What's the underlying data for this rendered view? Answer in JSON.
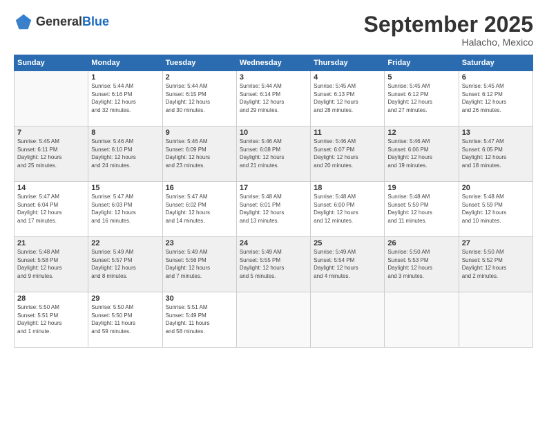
{
  "header": {
    "logo_general": "General",
    "logo_blue": "Blue",
    "month": "September 2025",
    "location": "Halacho, Mexico"
  },
  "days_of_week": [
    "Sunday",
    "Monday",
    "Tuesday",
    "Wednesday",
    "Thursday",
    "Friday",
    "Saturday"
  ],
  "weeks": [
    [
      {
        "day": "",
        "info": ""
      },
      {
        "day": "1",
        "info": "Sunrise: 5:44 AM\nSunset: 6:16 PM\nDaylight: 12 hours\nand 32 minutes."
      },
      {
        "day": "2",
        "info": "Sunrise: 5:44 AM\nSunset: 6:15 PM\nDaylight: 12 hours\nand 30 minutes."
      },
      {
        "day": "3",
        "info": "Sunrise: 5:44 AM\nSunset: 6:14 PM\nDaylight: 12 hours\nand 29 minutes."
      },
      {
        "day": "4",
        "info": "Sunrise: 5:45 AM\nSunset: 6:13 PM\nDaylight: 12 hours\nand 28 minutes."
      },
      {
        "day": "5",
        "info": "Sunrise: 5:45 AM\nSunset: 6:12 PM\nDaylight: 12 hours\nand 27 minutes."
      },
      {
        "day": "6",
        "info": "Sunrise: 5:45 AM\nSunset: 6:12 PM\nDaylight: 12 hours\nand 26 minutes."
      }
    ],
    [
      {
        "day": "7",
        "info": "Sunrise: 5:45 AM\nSunset: 6:11 PM\nDaylight: 12 hours\nand 25 minutes."
      },
      {
        "day": "8",
        "info": "Sunrise: 5:46 AM\nSunset: 6:10 PM\nDaylight: 12 hours\nand 24 minutes."
      },
      {
        "day": "9",
        "info": "Sunrise: 5:46 AM\nSunset: 6:09 PM\nDaylight: 12 hours\nand 23 minutes."
      },
      {
        "day": "10",
        "info": "Sunrise: 5:46 AM\nSunset: 6:08 PM\nDaylight: 12 hours\nand 21 minutes."
      },
      {
        "day": "11",
        "info": "Sunrise: 5:46 AM\nSunset: 6:07 PM\nDaylight: 12 hours\nand 20 minutes."
      },
      {
        "day": "12",
        "info": "Sunrise: 5:46 AM\nSunset: 6:06 PM\nDaylight: 12 hours\nand 19 minutes."
      },
      {
        "day": "13",
        "info": "Sunrise: 5:47 AM\nSunset: 6:05 PM\nDaylight: 12 hours\nand 18 minutes."
      }
    ],
    [
      {
        "day": "14",
        "info": "Sunrise: 5:47 AM\nSunset: 6:04 PM\nDaylight: 12 hours\nand 17 minutes."
      },
      {
        "day": "15",
        "info": "Sunrise: 5:47 AM\nSunset: 6:03 PM\nDaylight: 12 hours\nand 16 minutes."
      },
      {
        "day": "16",
        "info": "Sunrise: 5:47 AM\nSunset: 6:02 PM\nDaylight: 12 hours\nand 14 minutes."
      },
      {
        "day": "17",
        "info": "Sunrise: 5:48 AM\nSunset: 6:01 PM\nDaylight: 12 hours\nand 13 minutes."
      },
      {
        "day": "18",
        "info": "Sunrise: 5:48 AM\nSunset: 6:00 PM\nDaylight: 12 hours\nand 12 minutes."
      },
      {
        "day": "19",
        "info": "Sunrise: 5:48 AM\nSunset: 5:59 PM\nDaylight: 12 hours\nand 11 minutes."
      },
      {
        "day": "20",
        "info": "Sunrise: 5:48 AM\nSunset: 5:59 PM\nDaylight: 12 hours\nand 10 minutes."
      }
    ],
    [
      {
        "day": "21",
        "info": "Sunrise: 5:48 AM\nSunset: 5:58 PM\nDaylight: 12 hours\nand 9 minutes."
      },
      {
        "day": "22",
        "info": "Sunrise: 5:49 AM\nSunset: 5:57 PM\nDaylight: 12 hours\nand 8 minutes."
      },
      {
        "day": "23",
        "info": "Sunrise: 5:49 AM\nSunset: 5:56 PM\nDaylight: 12 hours\nand 7 minutes."
      },
      {
        "day": "24",
        "info": "Sunrise: 5:49 AM\nSunset: 5:55 PM\nDaylight: 12 hours\nand 5 minutes."
      },
      {
        "day": "25",
        "info": "Sunrise: 5:49 AM\nSunset: 5:54 PM\nDaylight: 12 hours\nand 4 minutes."
      },
      {
        "day": "26",
        "info": "Sunrise: 5:50 AM\nSunset: 5:53 PM\nDaylight: 12 hours\nand 3 minutes."
      },
      {
        "day": "27",
        "info": "Sunrise: 5:50 AM\nSunset: 5:52 PM\nDaylight: 12 hours\nand 2 minutes."
      }
    ],
    [
      {
        "day": "28",
        "info": "Sunrise: 5:50 AM\nSunset: 5:51 PM\nDaylight: 12 hours\nand 1 minute."
      },
      {
        "day": "29",
        "info": "Sunrise: 5:50 AM\nSunset: 5:50 PM\nDaylight: 11 hours\nand 59 minutes."
      },
      {
        "day": "30",
        "info": "Sunrise: 5:51 AM\nSunset: 5:49 PM\nDaylight: 11 hours\nand 58 minutes."
      },
      {
        "day": "",
        "info": ""
      },
      {
        "day": "",
        "info": ""
      },
      {
        "day": "",
        "info": ""
      },
      {
        "day": "",
        "info": ""
      }
    ]
  ]
}
